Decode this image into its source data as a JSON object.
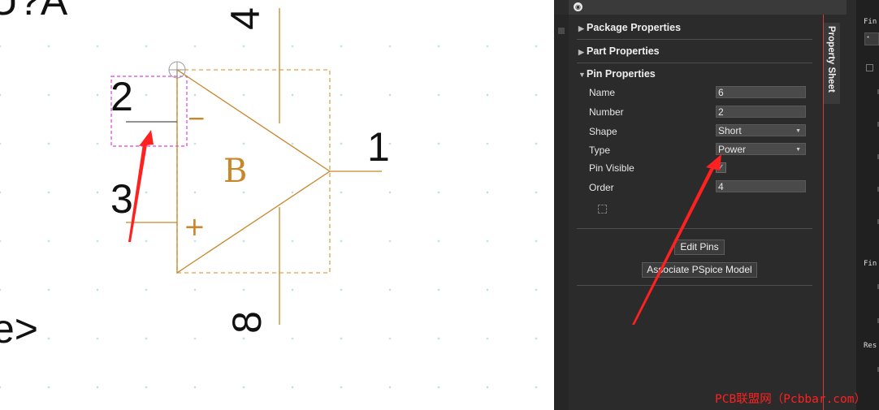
{
  "schematic": {
    "ref_fragment": "U?A",
    "value_fragment": "e>",
    "section_letter": "B",
    "pin_number_top": "4",
    "pin_number_bottom": "8",
    "pin_number_left_upper": "2",
    "pin_number_left_lower": "3",
    "pin_number_output": "1",
    "minus_sign": "−",
    "plus_sign": "+",
    "part_color": "#c8872a",
    "selection_color": "#e040e0"
  },
  "panel": {
    "tab_label": "Property Sheet",
    "sections": {
      "package_label": "Package Properties",
      "part_label": "Part Properties",
      "pin_label": "Pin Properties"
    },
    "pin_properties": {
      "name_label": "Name",
      "name_value": "6",
      "number_label": "Number",
      "number_value": "2",
      "shape_label": "Shape",
      "shape_value": "Short",
      "type_label": "Type",
      "type_value": "Power",
      "pin_visible_label": "Pin Visible",
      "pin_visible_checked": true,
      "order_label": "Order",
      "order_value": "4"
    },
    "buttons": {
      "edit_pins": "Edit Pins",
      "associate_pspice": "Associate PSpice Model"
    },
    "accent_color": "#d63a3a"
  },
  "right_strip": {
    "label_find_1": "Fin",
    "label_find_2": "Fin",
    "label_res": "Res",
    "input_value": "*"
  },
  "watermark": "PCB联盟网（Pcbbar.com）",
  "annotation_color": "#ff2020"
}
